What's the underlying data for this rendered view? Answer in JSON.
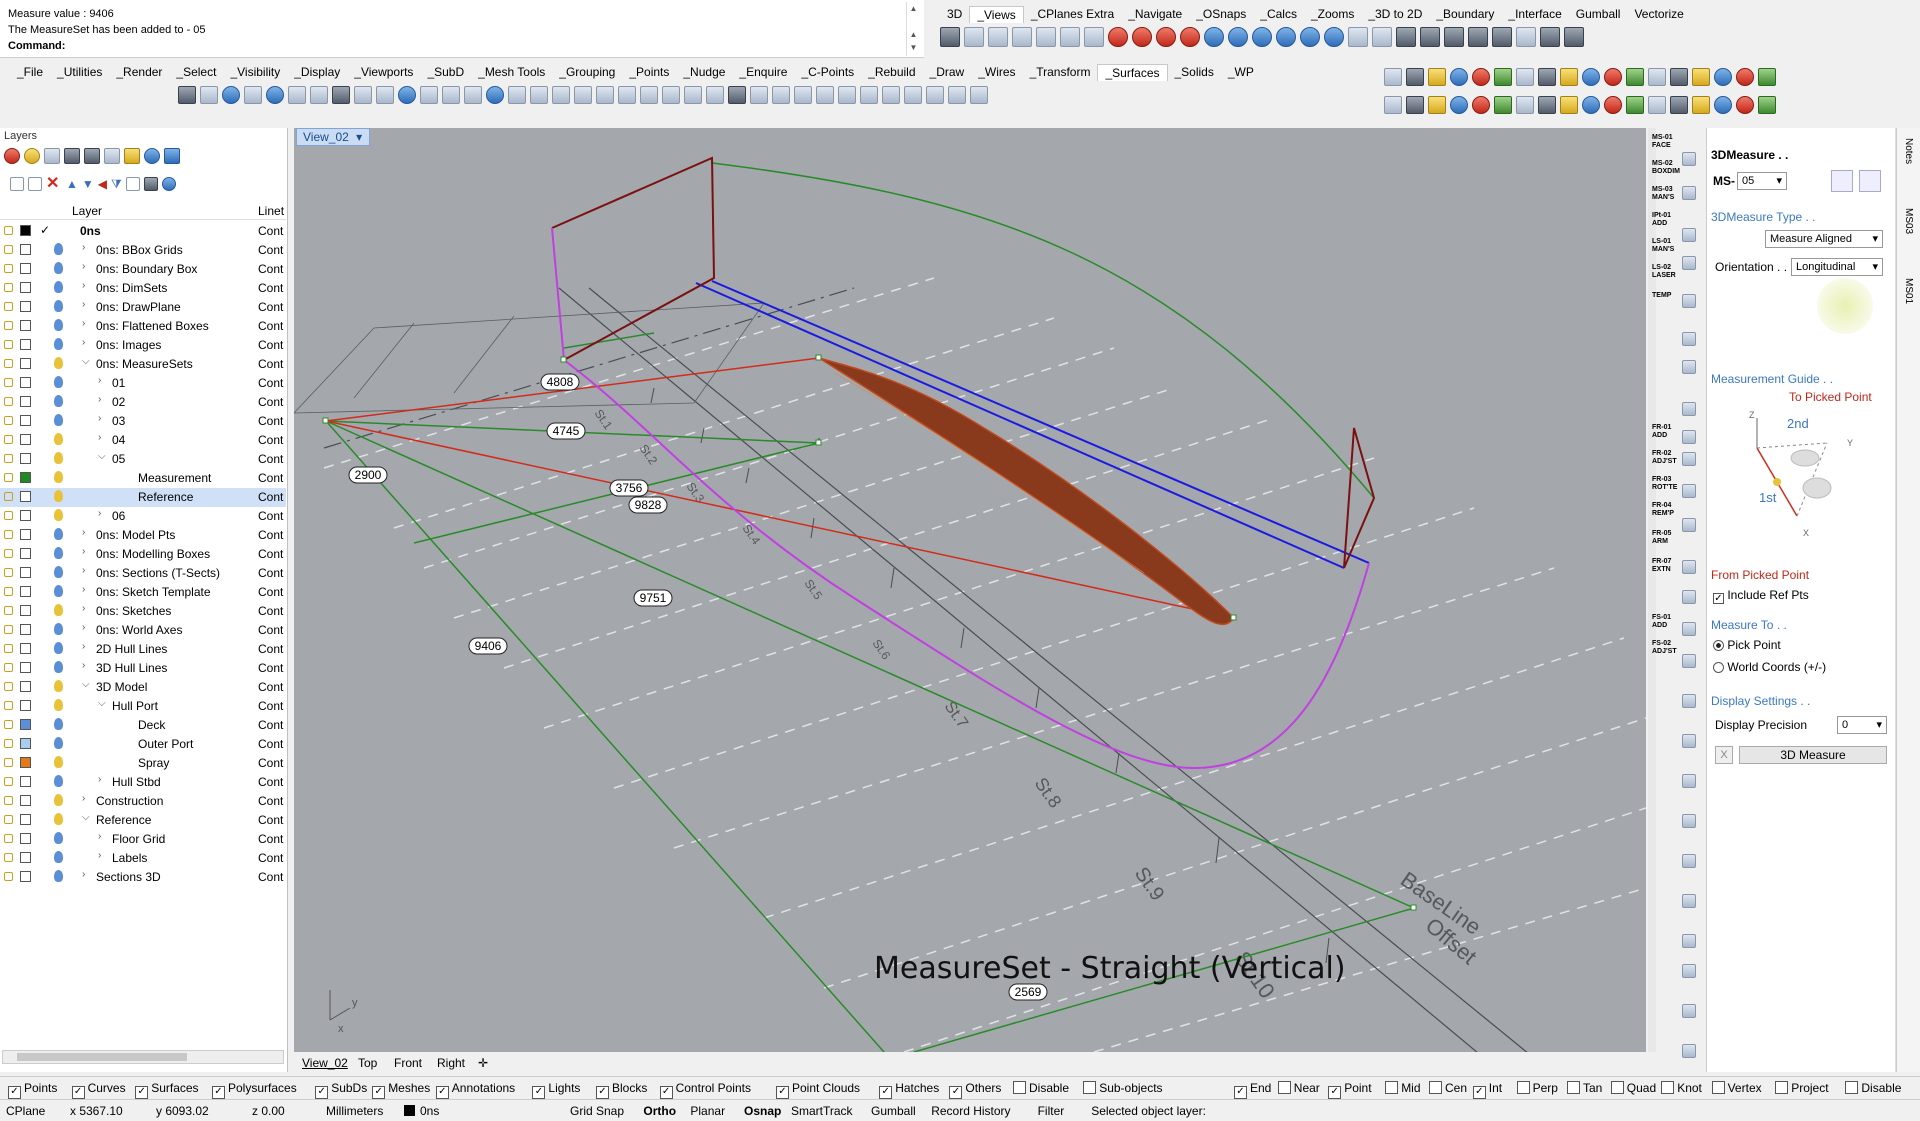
{
  "command_area": {
    "lines": [
      "Measure value : 9406",
      "The MeasureSet has been added to - 05"
    ],
    "prompt": "Command:"
  },
  "top_tabs": [
    "3D",
    "_Views",
    "_CPlanes Extra",
    "_Navigate",
    "_OSnaps",
    "_Calcs",
    "_Zooms",
    "_3D to 2D",
    "_Boundary",
    "_Interface",
    "Gumball",
    "Vectorize"
  ],
  "top_tabs_active": 1,
  "main_tabs": [
    "_File",
    "_Utilities",
    "_Render",
    "_Select",
    "_Visibility",
    "_Display",
    "_Viewports",
    "_SubD",
    "_Mesh Tools",
    "_Grouping",
    "_Points",
    "_Nudge",
    "_Enquire",
    "_C-Points",
    "_Rebuild",
    "_Draw",
    "_Wires",
    "_Transform",
    "_Surfaces",
    "_Solids",
    "_WP"
  ],
  "main_tabs_active": 18,
  "layers_panel": {
    "title": "Layers",
    "col_layer": "Layer",
    "col_linetype": "Linet",
    "rows": [
      {
        "name": "0ns",
        "indent": 0,
        "expand": "",
        "linetype": "Cont",
        "bulb": "none",
        "color": "#000000",
        "bold": true,
        "current": true
      },
      {
        "name": "0ns: BBox Grids",
        "indent": 1,
        "expand": ">",
        "linetype": "Cont",
        "bulb": "blue"
      },
      {
        "name": "0ns: Boundary Box",
        "indent": 1,
        "expand": ">",
        "linetype": "Cont",
        "bulb": "blue"
      },
      {
        "name": "0ns: DimSets",
        "indent": 1,
        "expand": ">",
        "linetype": "Cont",
        "bulb": "blue"
      },
      {
        "name": "0ns: DrawPlane",
        "indent": 1,
        "expand": ">",
        "linetype": "Cont",
        "bulb": "blue"
      },
      {
        "name": "0ns: Flattened Boxes",
        "indent": 1,
        "expand": ">",
        "linetype": "Cont",
        "bulb": "blue"
      },
      {
        "name": "0ns: Images",
        "indent": 1,
        "expand": ">",
        "linetype": "Cont",
        "bulb": "blue"
      },
      {
        "name": "0ns: MeasureSets",
        "indent": 1,
        "expand": "v",
        "linetype": "Cont",
        "bulb": "yellow"
      },
      {
        "name": "01",
        "indent": 2,
        "expand": ">",
        "linetype": "Cont",
        "bulb": "blue"
      },
      {
        "name": "02",
        "indent": 2,
        "expand": ">",
        "linetype": "Cont",
        "bulb": "blue"
      },
      {
        "name": "03",
        "indent": 2,
        "expand": ">",
        "linetype": "Cont",
        "bulb": "blue"
      },
      {
        "name": "04",
        "indent": 2,
        "expand": ">",
        "linetype": "Cont",
        "bulb": "yellow"
      },
      {
        "name": "05",
        "indent": 2,
        "expand": "v",
        "linetype": "Cont",
        "bulb": "yellow"
      },
      {
        "name": "Measurement",
        "indent": 3,
        "expand": "",
        "linetype": "Cont",
        "bulb": "yellow",
        "color": "#1f8a1f"
      },
      {
        "name": "Reference",
        "indent": 3,
        "expand": "",
        "linetype": "Cont",
        "bulb": "yellow",
        "color": "#ffffff",
        "selected": true
      },
      {
        "name": "06",
        "indent": 2,
        "expand": ">",
        "linetype": "Cont",
        "bulb": "yellow"
      },
      {
        "name": "0ns: Model Pts",
        "indent": 1,
        "expand": ">",
        "linetype": "Cont",
        "bulb": "blue"
      },
      {
        "name": "0ns: Modelling Boxes",
        "indent": 1,
        "expand": ">",
        "linetype": "Cont",
        "bulb": "blue"
      },
      {
        "name": "0ns: Sections (T-Sects)",
        "indent": 1,
        "expand": ">",
        "linetype": "Cont",
        "bulb": "blue"
      },
      {
        "name": "0ns: Sketch Template",
        "indent": 1,
        "expand": ">",
        "linetype": "Cont",
        "bulb": "blue"
      },
      {
        "name": "0ns: Sketches",
        "indent": 1,
        "expand": ">",
        "linetype": "Cont",
        "bulb": "yellow"
      },
      {
        "name": "0ns: World Axes",
        "indent": 1,
        "expand": ">",
        "linetype": "Cont",
        "bulb": "blue"
      },
      {
        "name": "2D Hull Lines",
        "indent": 1,
        "expand": ">",
        "linetype": "Cont",
        "bulb": "blue"
      },
      {
        "name": "3D Hull Lines",
        "indent": 1,
        "expand": ">",
        "linetype": "Cont",
        "bulb": "blue"
      },
      {
        "name": "3D Model",
        "indent": 1,
        "expand": "v",
        "linetype": "Cont",
        "bulb": "yellow"
      },
      {
        "name": "Hull Port",
        "indent": 2,
        "expand": "v",
        "linetype": "Cont",
        "bulb": "yellow"
      },
      {
        "name": "Deck",
        "indent": 3,
        "expand": "",
        "linetype": "Cont",
        "bulb": "blue",
        "color": "#5b8fd8"
      },
      {
        "name": "Outer Port",
        "indent": 3,
        "expand": "",
        "linetype": "Cont",
        "bulb": "blue",
        "color": "#a9cdf0"
      },
      {
        "name": "Spray",
        "indent": 3,
        "expand": "",
        "linetype": "Cont",
        "bulb": "yellow",
        "color": "#e27a1a"
      },
      {
        "name": "Hull Stbd",
        "indent": 2,
        "expand": ">",
        "linetype": "Cont",
        "bulb": "blue"
      },
      {
        "name": "Construction",
        "indent": 1,
        "expand": ">",
        "linetype": "Cont",
        "bulb": "yellow"
      },
      {
        "name": "Reference",
        "indent": 1,
        "expand": "v",
        "linetype": "Cont",
        "bulb": "yellow"
      },
      {
        "name": "Floor Grid",
        "indent": 2,
        "expand": ">",
        "linetype": "Cont",
        "bulb": "blue"
      },
      {
        "name": "Labels",
        "indent": 2,
        "expand": ">",
        "linetype": "Cont",
        "bulb": "blue"
      },
      {
        "name": "Sections 3D",
        "indent": 1,
        "expand": ">",
        "linetype": "Cont",
        "bulb": "blue"
      }
    ]
  },
  "viewport": {
    "name": "View_02",
    "caption": "MeasureSet - Straight (Vertical)",
    "dimensions": [
      "4808",
      "4745",
      "2900",
      "3756",
      "9828",
      "9751",
      "9406",
      "2569"
    ],
    "station_labels": [
      "St.3",
      "St.4",
      "St.5",
      "St.6",
      "St.7",
      "St.8",
      "St.9",
      "St.10"
    ],
    "line_labels": [
      "BaseLine",
      "Offset"
    ],
    "axes": {
      "x": "x",
      "y": "y"
    }
  },
  "view_tabs": [
    "View_02",
    "Top",
    "Front",
    "Right"
  ],
  "side_icon_labels": [
    "MS-01 FACE",
    "MS-02 BOXDIM",
    "MS-03 MAN'S",
    "IPt-01 ADD",
    "LS-01 MAN'S",
    "LS-02 LASER",
    "TEMP",
    "FR-01 ADD",
    "FR-02 ADJ'ST",
    "FR-03 ROT'TE",
    "FR-04 REM'P",
    "FR-05 ARM",
    "FR-07 EXTN",
    "FS-01 ADD",
    "FS-02 ADJ'ST"
  ],
  "right_panel": {
    "title": "3DMeasure . .",
    "ms_label": "MS-",
    "ms_value": "05",
    "type_heading": "3DMeasure Type . .",
    "type_value": "Measure Aligned",
    "orientation_label": "Orientation . .",
    "orientation_value": "Longitudinal",
    "guide_heading": "Measurement Guide . .",
    "to_picked": "To Picked Point",
    "guide_2nd": "2nd",
    "guide_1st": "1st",
    "from_picked": "From Picked Point",
    "include_ref": "Include Ref Pts",
    "measure_to_heading": "Measure To . .",
    "pick_point": "Pick Point",
    "world_coords": "World Coords (+/-)",
    "display_heading": "Display Settings . .",
    "precision_label": "Display Precision",
    "precision_value": "0",
    "x_btn": "X",
    "measure_btn": "3D Measure",
    "side_tabs": [
      "Notes",
      "MS03",
      "MS01"
    ]
  },
  "filter_bar": {
    "left": [
      {
        "label": "Points",
        "on": true
      },
      {
        "label": "Curves",
        "on": true
      },
      {
        "label": "Surfaces",
        "on": true
      },
      {
        "label": "Polysurfaces",
        "on": true
      },
      {
        "label": "SubDs",
        "on": true
      },
      {
        "label": "Meshes",
        "on": true
      },
      {
        "label": "Annotations",
        "on": true
      },
      {
        "label": "Lights",
        "on": true
      },
      {
        "label": "Blocks",
        "on": true
      },
      {
        "label": "Control Points",
        "on": true
      },
      {
        "label": "Point Clouds",
        "on": true
      },
      {
        "label": "Hatches",
        "on": true
      },
      {
        "label": "Others",
        "on": true
      },
      {
        "label": "Disable",
        "on": false
      },
      {
        "label": "Sub-objects",
        "on": false
      }
    ],
    "right": [
      {
        "label": "End",
        "on": true
      },
      {
        "label": "Near",
        "on": false
      },
      {
        "label": "Point",
        "on": true
      },
      {
        "label": "Mid",
        "on": false
      },
      {
        "label": "Cen",
        "on": false
      },
      {
        "label": "Int",
        "on": true
      },
      {
        "label": "Perp",
        "on": false
      },
      {
        "label": "Tan",
        "on": false
      },
      {
        "label": "Quad",
        "on": false
      },
      {
        "label": "Knot",
        "on": false
      },
      {
        "label": "Vertex",
        "on": false
      },
      {
        "label": "Project",
        "on": false
      },
      {
        "label": "Disable",
        "on": false
      }
    ]
  },
  "status_bar": {
    "cplane": "CPlane",
    "x": "x 5367.10",
    "y": "y 6093.02",
    "z": "z 0.00",
    "units": "Millimeters",
    "layer": "0ns",
    "items": [
      "Grid Snap",
      "Ortho",
      "Planar",
      "Osnap",
      "SmartTrack",
      "Gumball",
      "Record History",
      "Filter"
    ],
    "bold_items": [
      "Ortho",
      "Osnap"
    ],
    "message": "Selected object layer:"
  },
  "colors": {
    "viewport_bg": "#a4a8ad",
    "hull_fill": "#8a3a1c",
    "red_line": "#d42a1a",
    "green_line": "#2a8a2a",
    "blue_line": "#1a1ae0",
    "magenta_line": "#c040e0",
    "dark_red_line": "#7a1010",
    "accent_blue": "#3b78c4"
  }
}
